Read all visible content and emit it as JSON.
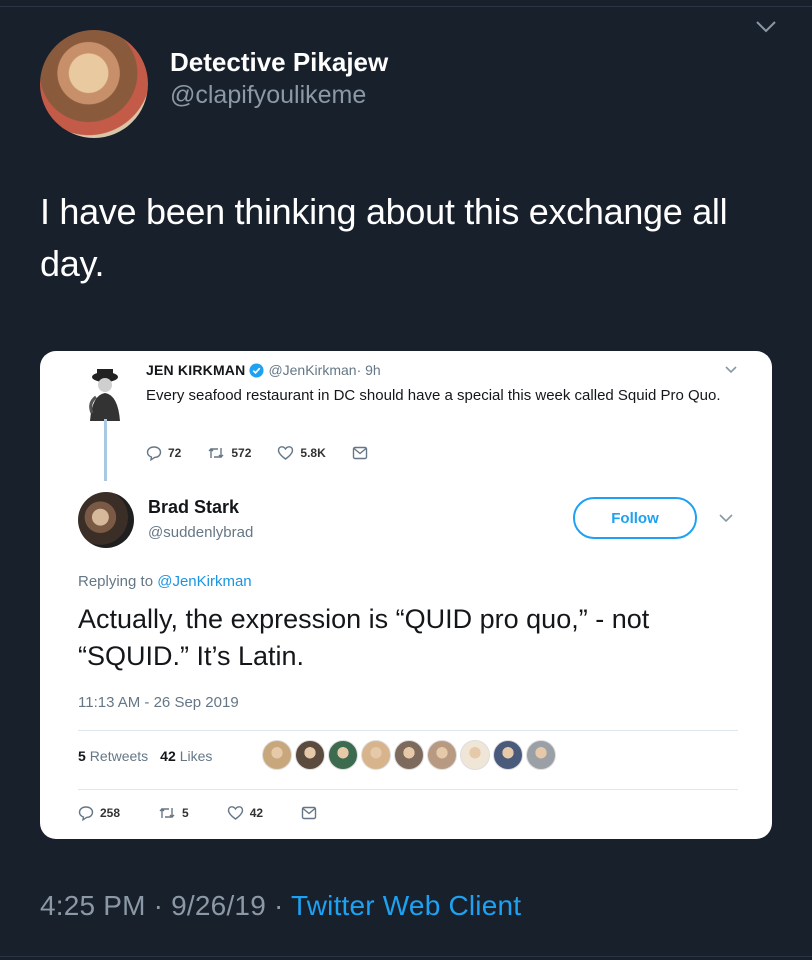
{
  "tweet": {
    "display_name": "Detective Pikajew",
    "handle": "@clapifyoulikeme",
    "text": "I have been thinking about this exchange all day.",
    "timestamp": "4:25 PM · 9/26/19 · ",
    "client": "Twitter Web Client",
    "avatar_icon": "avatar-photo"
  },
  "quoted": {
    "original": {
      "name": "JEN KIRKMAN",
      "handle": "@JenKirkman",
      "age": " · 9h",
      "text": "Every seafood restaurant in DC should have a special this week called Squid Pro Quo.",
      "replies": "72",
      "retweets": "572",
      "likes": "5.8K"
    },
    "reply": {
      "name": "Brad Stark",
      "handle": "@suddenlybrad",
      "follow_label": "Follow",
      "replying_prefix": "Replying to ",
      "replying_to": "@JenKirkman",
      "text": "Actually, the expression is “QUID pro quo,” - not “SQUID.” It’s Latin.",
      "time": "11:13 AM - 26 Sep 2019",
      "retweets_count": "5",
      "retweets_label": "Retweets",
      "likes_count": "42",
      "likes_label": "Likes",
      "replies": "258",
      "retweets": "5",
      "likes": "42"
    },
    "liker_colors": [
      "#c9a77c",
      "#5b4a3e",
      "#3d6b4f",
      "#d8b48c",
      "#7e6a5c",
      "#b89a82",
      "#f0e6d8",
      "#4a5a7a",
      "#9aa0a6"
    ]
  },
  "colors": {
    "background": "#18202c",
    "accent": "#1da1f2",
    "muted": "#8b98a5"
  }
}
